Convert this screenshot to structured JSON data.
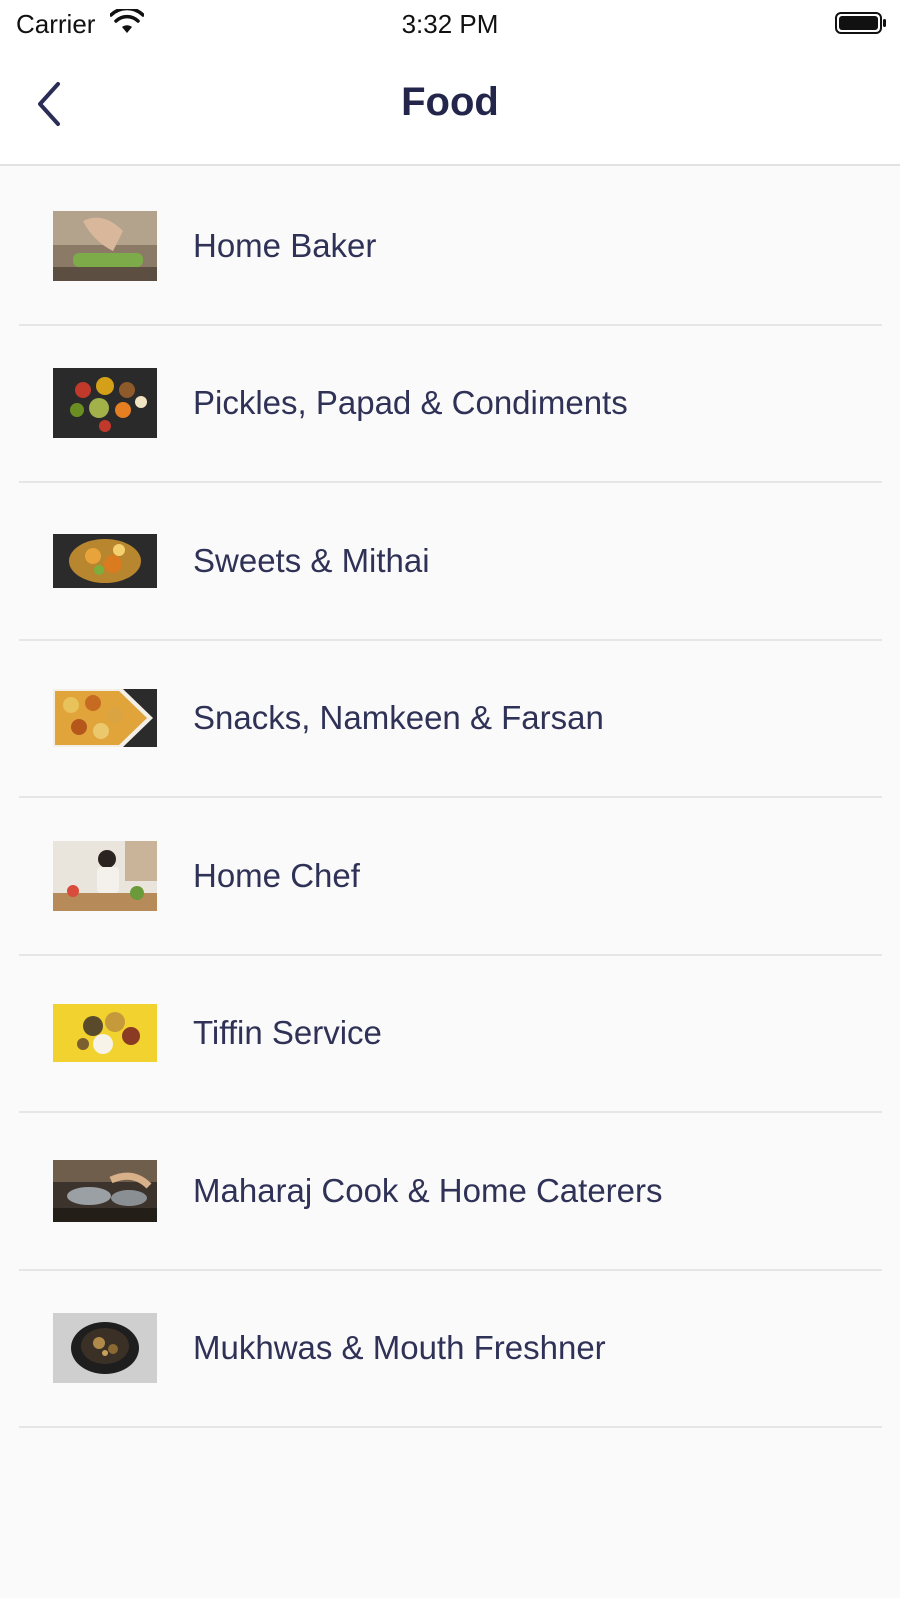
{
  "status_bar": {
    "carrier": "Carrier",
    "time": "3:32 PM"
  },
  "nav": {
    "title": "Food",
    "back_icon": "chevron-left-icon"
  },
  "colors": {
    "title": "#23264a",
    "text": "#2f3256",
    "background": "#fafafa",
    "divider": "#e6e6e6"
  },
  "categories": [
    {
      "label": "Home Baker",
      "thumb": "home-baker-thumbnail"
    },
    {
      "label": "Pickles, Papad & Condiments",
      "thumb": "pickles-thumbnail"
    },
    {
      "label": "Sweets & Mithai",
      "thumb": "sweets-thumbnail"
    },
    {
      "label": "Snacks, Namkeen & Farsan",
      "thumb": "snacks-thumbnail"
    },
    {
      "label": "Home Chef",
      "thumb": "home-chef-thumbnail"
    },
    {
      "label": "Tiffin Service",
      "thumb": "tiffin-thumbnail"
    },
    {
      "label": "Maharaj Cook & Home Caterers",
      "thumb": "caterers-thumbnail"
    },
    {
      "label": "Mukhwas & Mouth Freshner",
      "thumb": "mukhwas-thumbnail"
    }
  ]
}
